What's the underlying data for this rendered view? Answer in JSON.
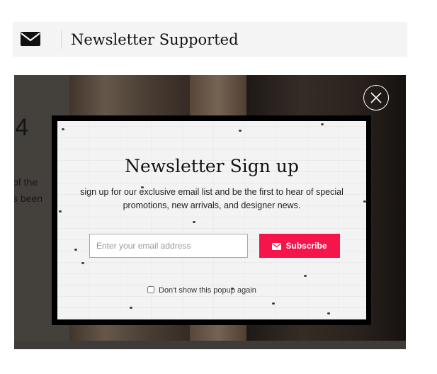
{
  "header": {
    "title": "Newsletter Supported",
    "icon": "envelope-icon"
  },
  "background": {
    "partial_number": ".4",
    "partial_line1": "of the",
    "partial_line2": "s been"
  },
  "popup": {
    "title": "Newsletter Sign up",
    "description": "sign up for our exclusive email list and be the first to hear of special promotions, new arrivals, and designer news.",
    "email_placeholder": "Enter your email address",
    "email_value": "",
    "subscribe_label": "Subscribe",
    "subscribe_icon": "envelope-icon",
    "dont_show_label": "Don't show this popup again",
    "dont_show_checked": false,
    "close_icon": "close-icon"
  },
  "colors": {
    "accent": "#f5154a",
    "header_bg": "#f4f4f4",
    "popup_border": "#000000"
  }
}
